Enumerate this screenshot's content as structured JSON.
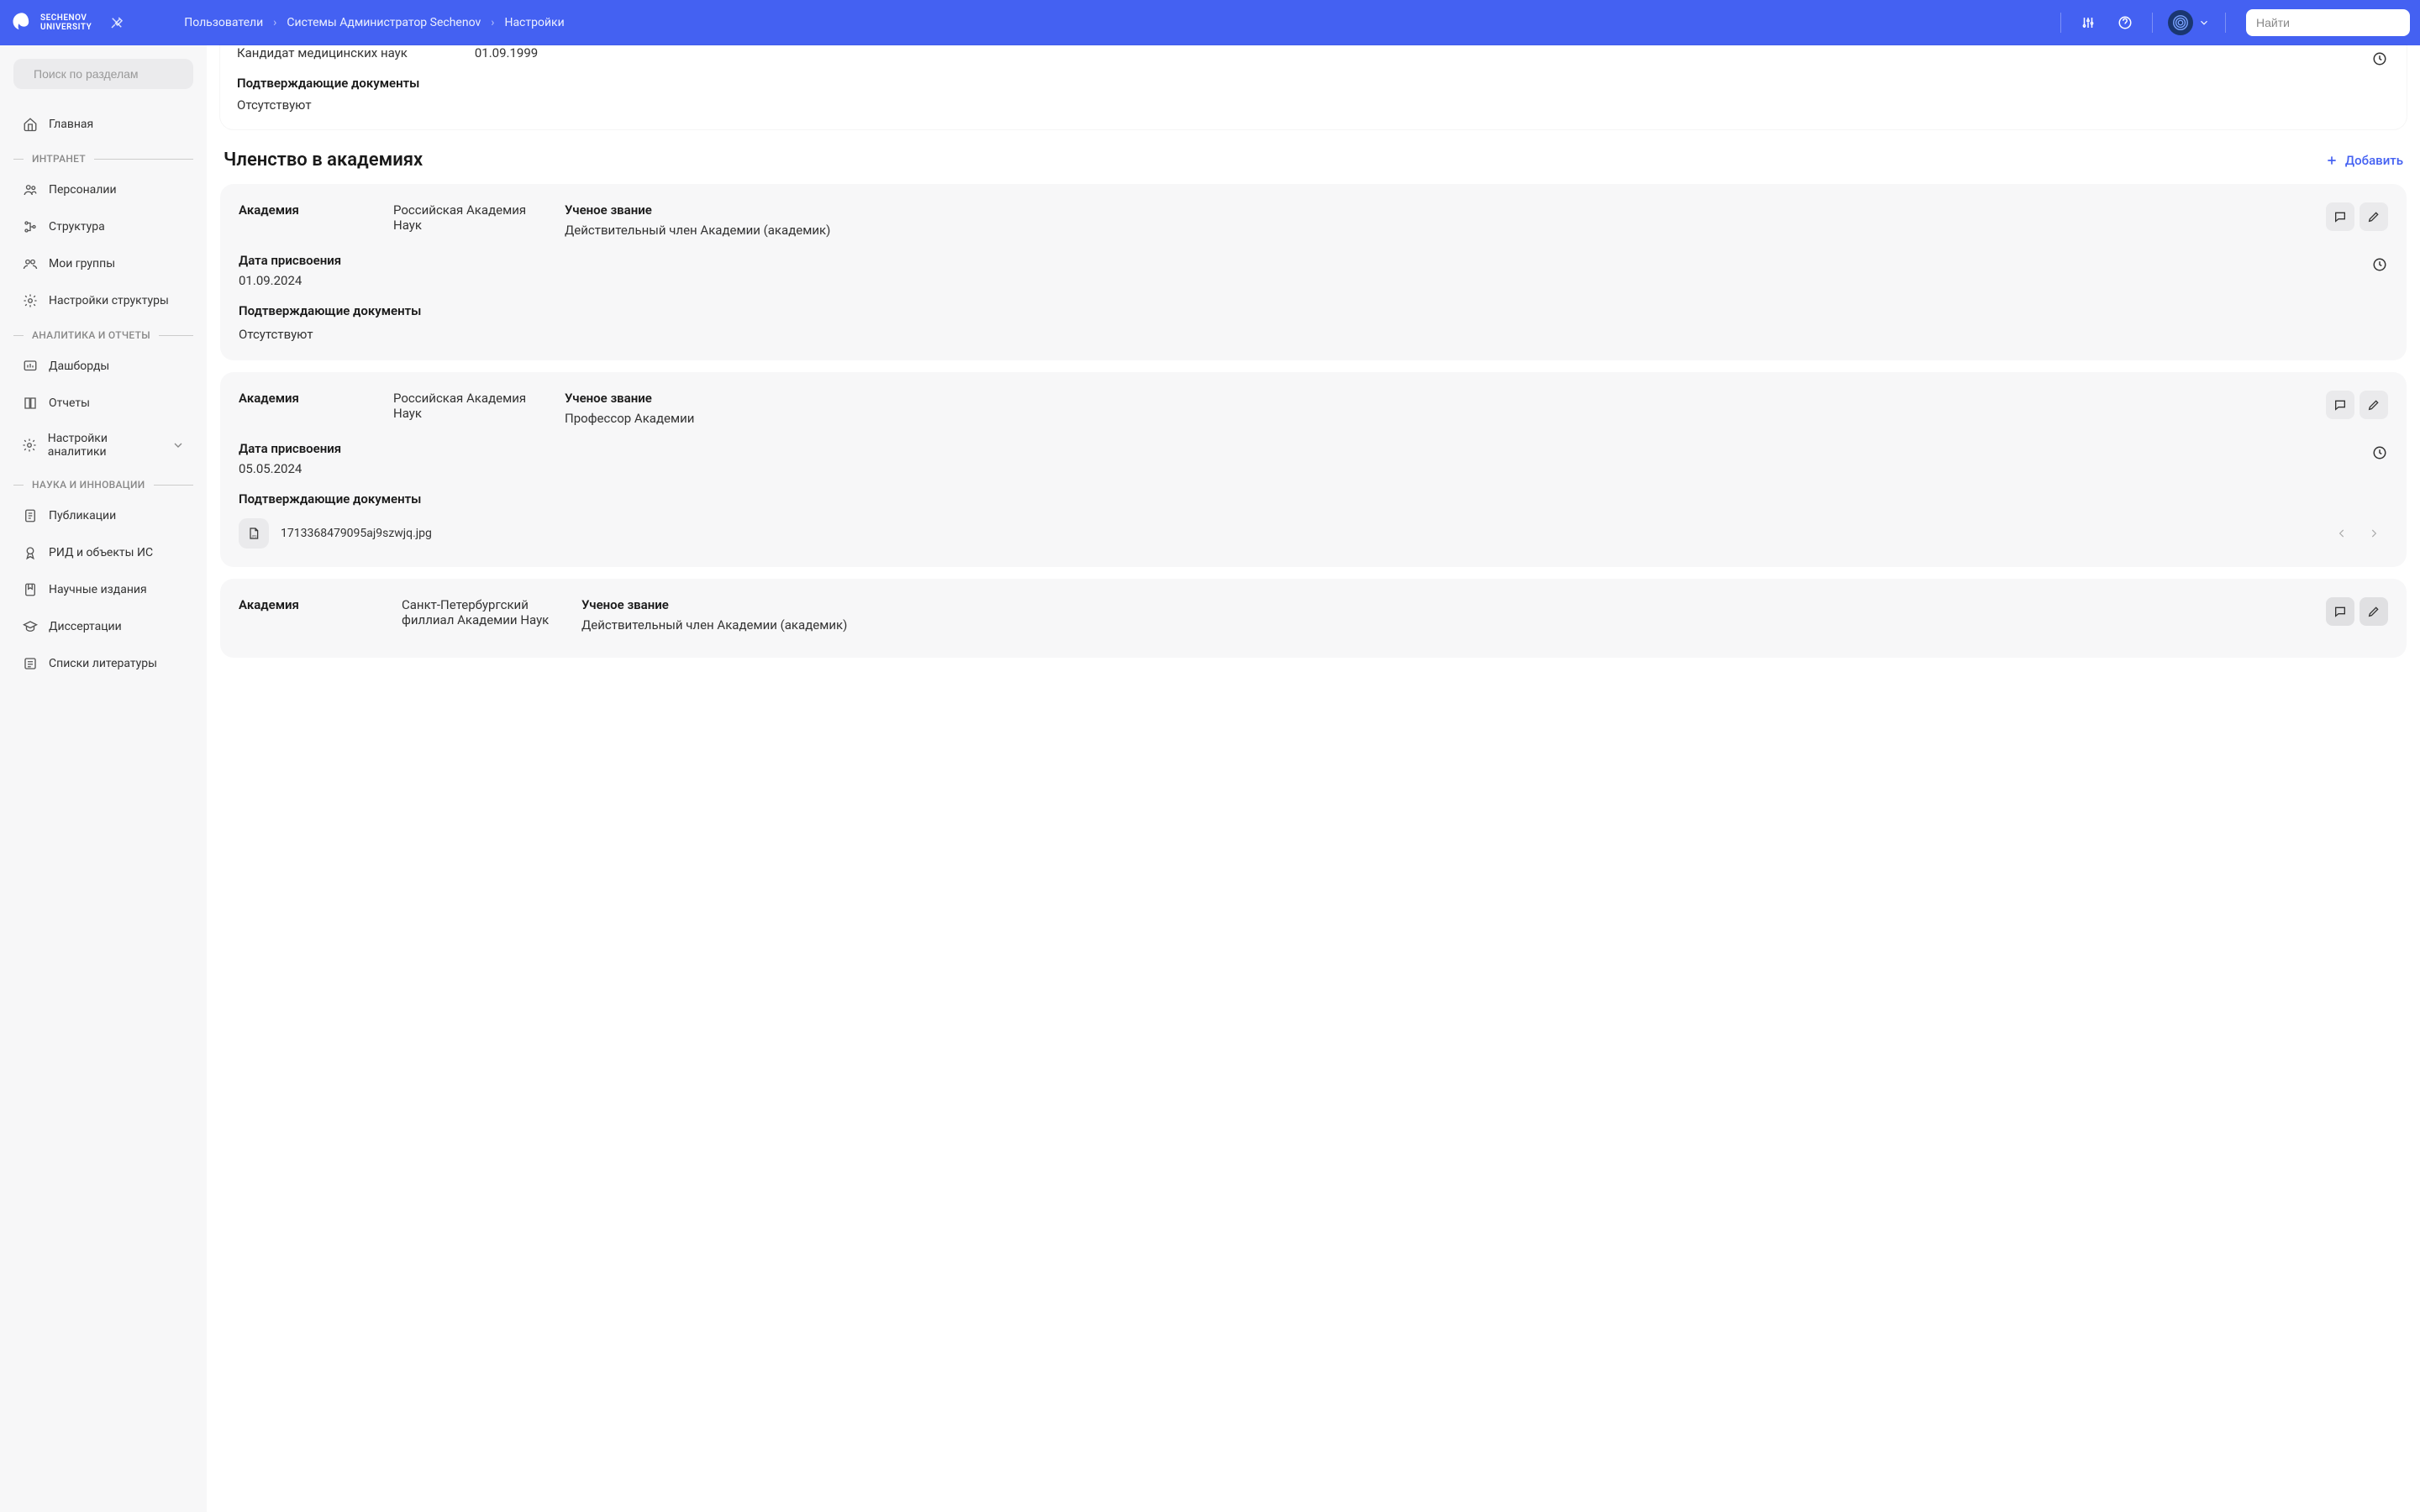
{
  "header": {
    "logo_line1": "SECHENOV",
    "logo_line2": "UNIVERSITY",
    "breadcrumbs": [
      "Пользователи",
      "Системы Администратор Sechenov",
      "Настройки"
    ],
    "search_placeholder": "Найти"
  },
  "sidebar": {
    "search_placeholder": "Поиск по разделам",
    "home": "Главная",
    "sections": [
      {
        "title": "ИНТРАНЕТ",
        "items": [
          "Персоналии",
          "Структура",
          "Мои группы",
          "Настройки структуры"
        ]
      },
      {
        "title": "АНАЛИТИКА И ОТЧЕТЫ",
        "items": [
          "Дашборды",
          "Отчеты",
          "Настройки аналитики"
        ]
      },
      {
        "title": "НАУКА И ИННОВАЦИИ",
        "items": [
          "Публикации",
          "РИД и объекты ИС",
          "Научные издания",
          "Диссертации",
          "Списки литературы"
        ]
      }
    ]
  },
  "partial_top": {
    "degree_value": "Кандидат медицинских наук",
    "degree_date": "01.09.1999",
    "docs_label": "Подтверждающие документы",
    "docs_value": "Отсутствуют"
  },
  "membership_section": {
    "title": "Членство в академиях",
    "add_label": "Добавить",
    "labels": {
      "academy": "Академия",
      "title": "Ученое звание",
      "date": "Дата присвоения",
      "docs": "Подтверждающие документы",
      "absent": "Отсутствуют"
    },
    "items": [
      {
        "academy": "Российская Академия Наук",
        "title": "Действительный член Академии (академик)",
        "date": "01.09.2024",
        "docs": null
      },
      {
        "academy": "Российская Академия Наук",
        "title": "Профессор Академии",
        "date": "05.05.2024",
        "docs": "1713368479095aj9szwjq.jpg"
      },
      {
        "academy": "Санкт-Петербургский филлиал Академии Наук",
        "title": "Действительный член Академии (академик)",
        "date": null,
        "docs": null
      }
    ]
  }
}
